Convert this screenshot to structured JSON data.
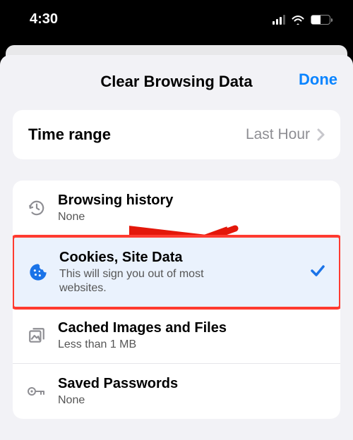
{
  "status": {
    "time": "4:30"
  },
  "header": {
    "title": "Clear Browsing Data",
    "done": "Done"
  },
  "timeRange": {
    "label": "Time range",
    "value": "Last Hour"
  },
  "items": [
    {
      "title": "Browsing history",
      "sub": "None"
    },
    {
      "title": "Cookies, Site Data",
      "sub": "This will sign you out of most websites."
    },
    {
      "title": "Cached Images and Files",
      "sub": "Less than 1 MB"
    },
    {
      "title": "Saved Passwords",
      "sub": "None"
    }
  ]
}
